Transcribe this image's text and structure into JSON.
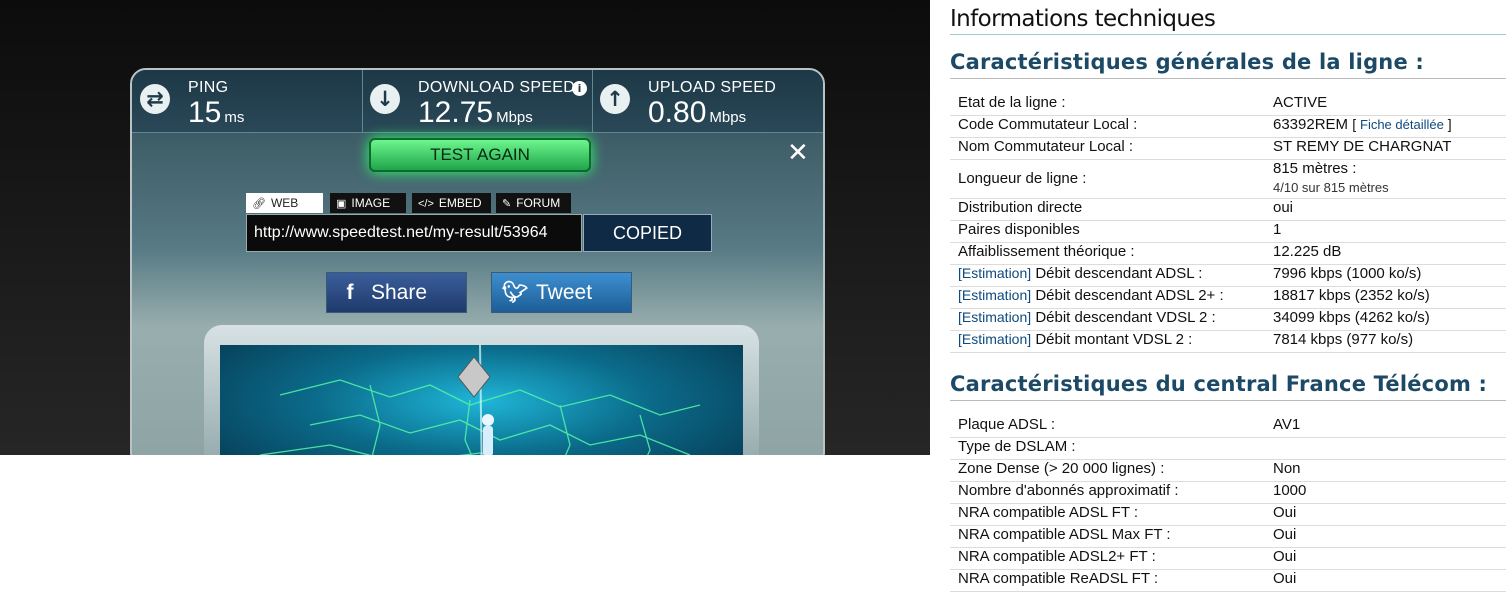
{
  "speedtest": {
    "ping": {
      "label": "PING",
      "value": "15",
      "unit": "ms"
    },
    "download": {
      "label": "DOWNLOAD SPEED",
      "value": "12.75",
      "unit": "Mbps"
    },
    "upload": {
      "label": "UPLOAD SPEED",
      "value": "0.80",
      "unit": "Mbps"
    },
    "test_again_label": "TEST AGAIN",
    "share_tabs": [
      "WEB",
      "IMAGE",
      "EMBED",
      "FORUM"
    ],
    "active_share_tab": "WEB",
    "result_url": "http://www.speedtest.net/my-result/53964",
    "copied_label": "COPIED",
    "facebook_label": "Share",
    "twitter_label": "Tweet",
    "colors": {
      "accent_green": "#1ea64a",
      "panel_dark": "#1d3846"
    }
  },
  "info": {
    "title": "Informations techniques",
    "section1": {
      "title": "Caractéristiques générales de la ligne :",
      "rows": [
        {
          "key": "Etat de la ligne :",
          "value": "ACTIVE"
        },
        {
          "key": "Code Commutateur Local :",
          "value": "63392REM",
          "link": "Fiche détaillée"
        },
        {
          "key": "Nom Commutateur Local :",
          "value": "ST REMY DE CHARGNAT"
        },
        {
          "key": "Longueur de ligne :",
          "value": "815 mètres :",
          "sub": "4/10 sur 815 mètres"
        },
        {
          "key": "Distribution directe",
          "value": "oui"
        },
        {
          "key": "Paires disponibles",
          "value": "1"
        },
        {
          "key": "Affaiblissement théorique :",
          "value": "12.225 dB"
        },
        {
          "prefix": "[Estimation]",
          "key": "Débit descendant ADSL :",
          "value": "7996 kbps (1000 ko/s)"
        },
        {
          "prefix": "[Estimation]",
          "key": "Débit descendant ADSL 2+ :",
          "value": "18817 kbps (2352 ko/s)"
        },
        {
          "prefix": "[Estimation]",
          "key": "Débit descendant VDSL 2 :",
          "value": "34099 kbps (4262 ko/s)"
        },
        {
          "prefix": "[Estimation]",
          "key": "Débit montant VDSL 2 :",
          "value": "7814 kbps (977 ko/s)"
        }
      ]
    },
    "section2": {
      "title": "Caractéristiques du central France Télécom :",
      "rows": [
        {
          "key": "Plaque ADSL :",
          "value": "AV1"
        },
        {
          "key": "Type de DSLAM :",
          "value": ""
        },
        {
          "key": "Zone Dense (> 20 000 lignes) :",
          "value": "Non"
        },
        {
          "key": "Nombre d'abonnés approximatif :",
          "value": "1000"
        },
        {
          "key": "NRA compatible ADSL FT :",
          "value": "Oui"
        },
        {
          "key": "NRA compatible ADSL Max FT :",
          "value": "Oui"
        },
        {
          "key": "NRA compatible ADSL2+ FT :",
          "value": "Oui"
        },
        {
          "key": "NRA compatible ReADSL FT :",
          "value": "Oui"
        }
      ]
    }
  }
}
